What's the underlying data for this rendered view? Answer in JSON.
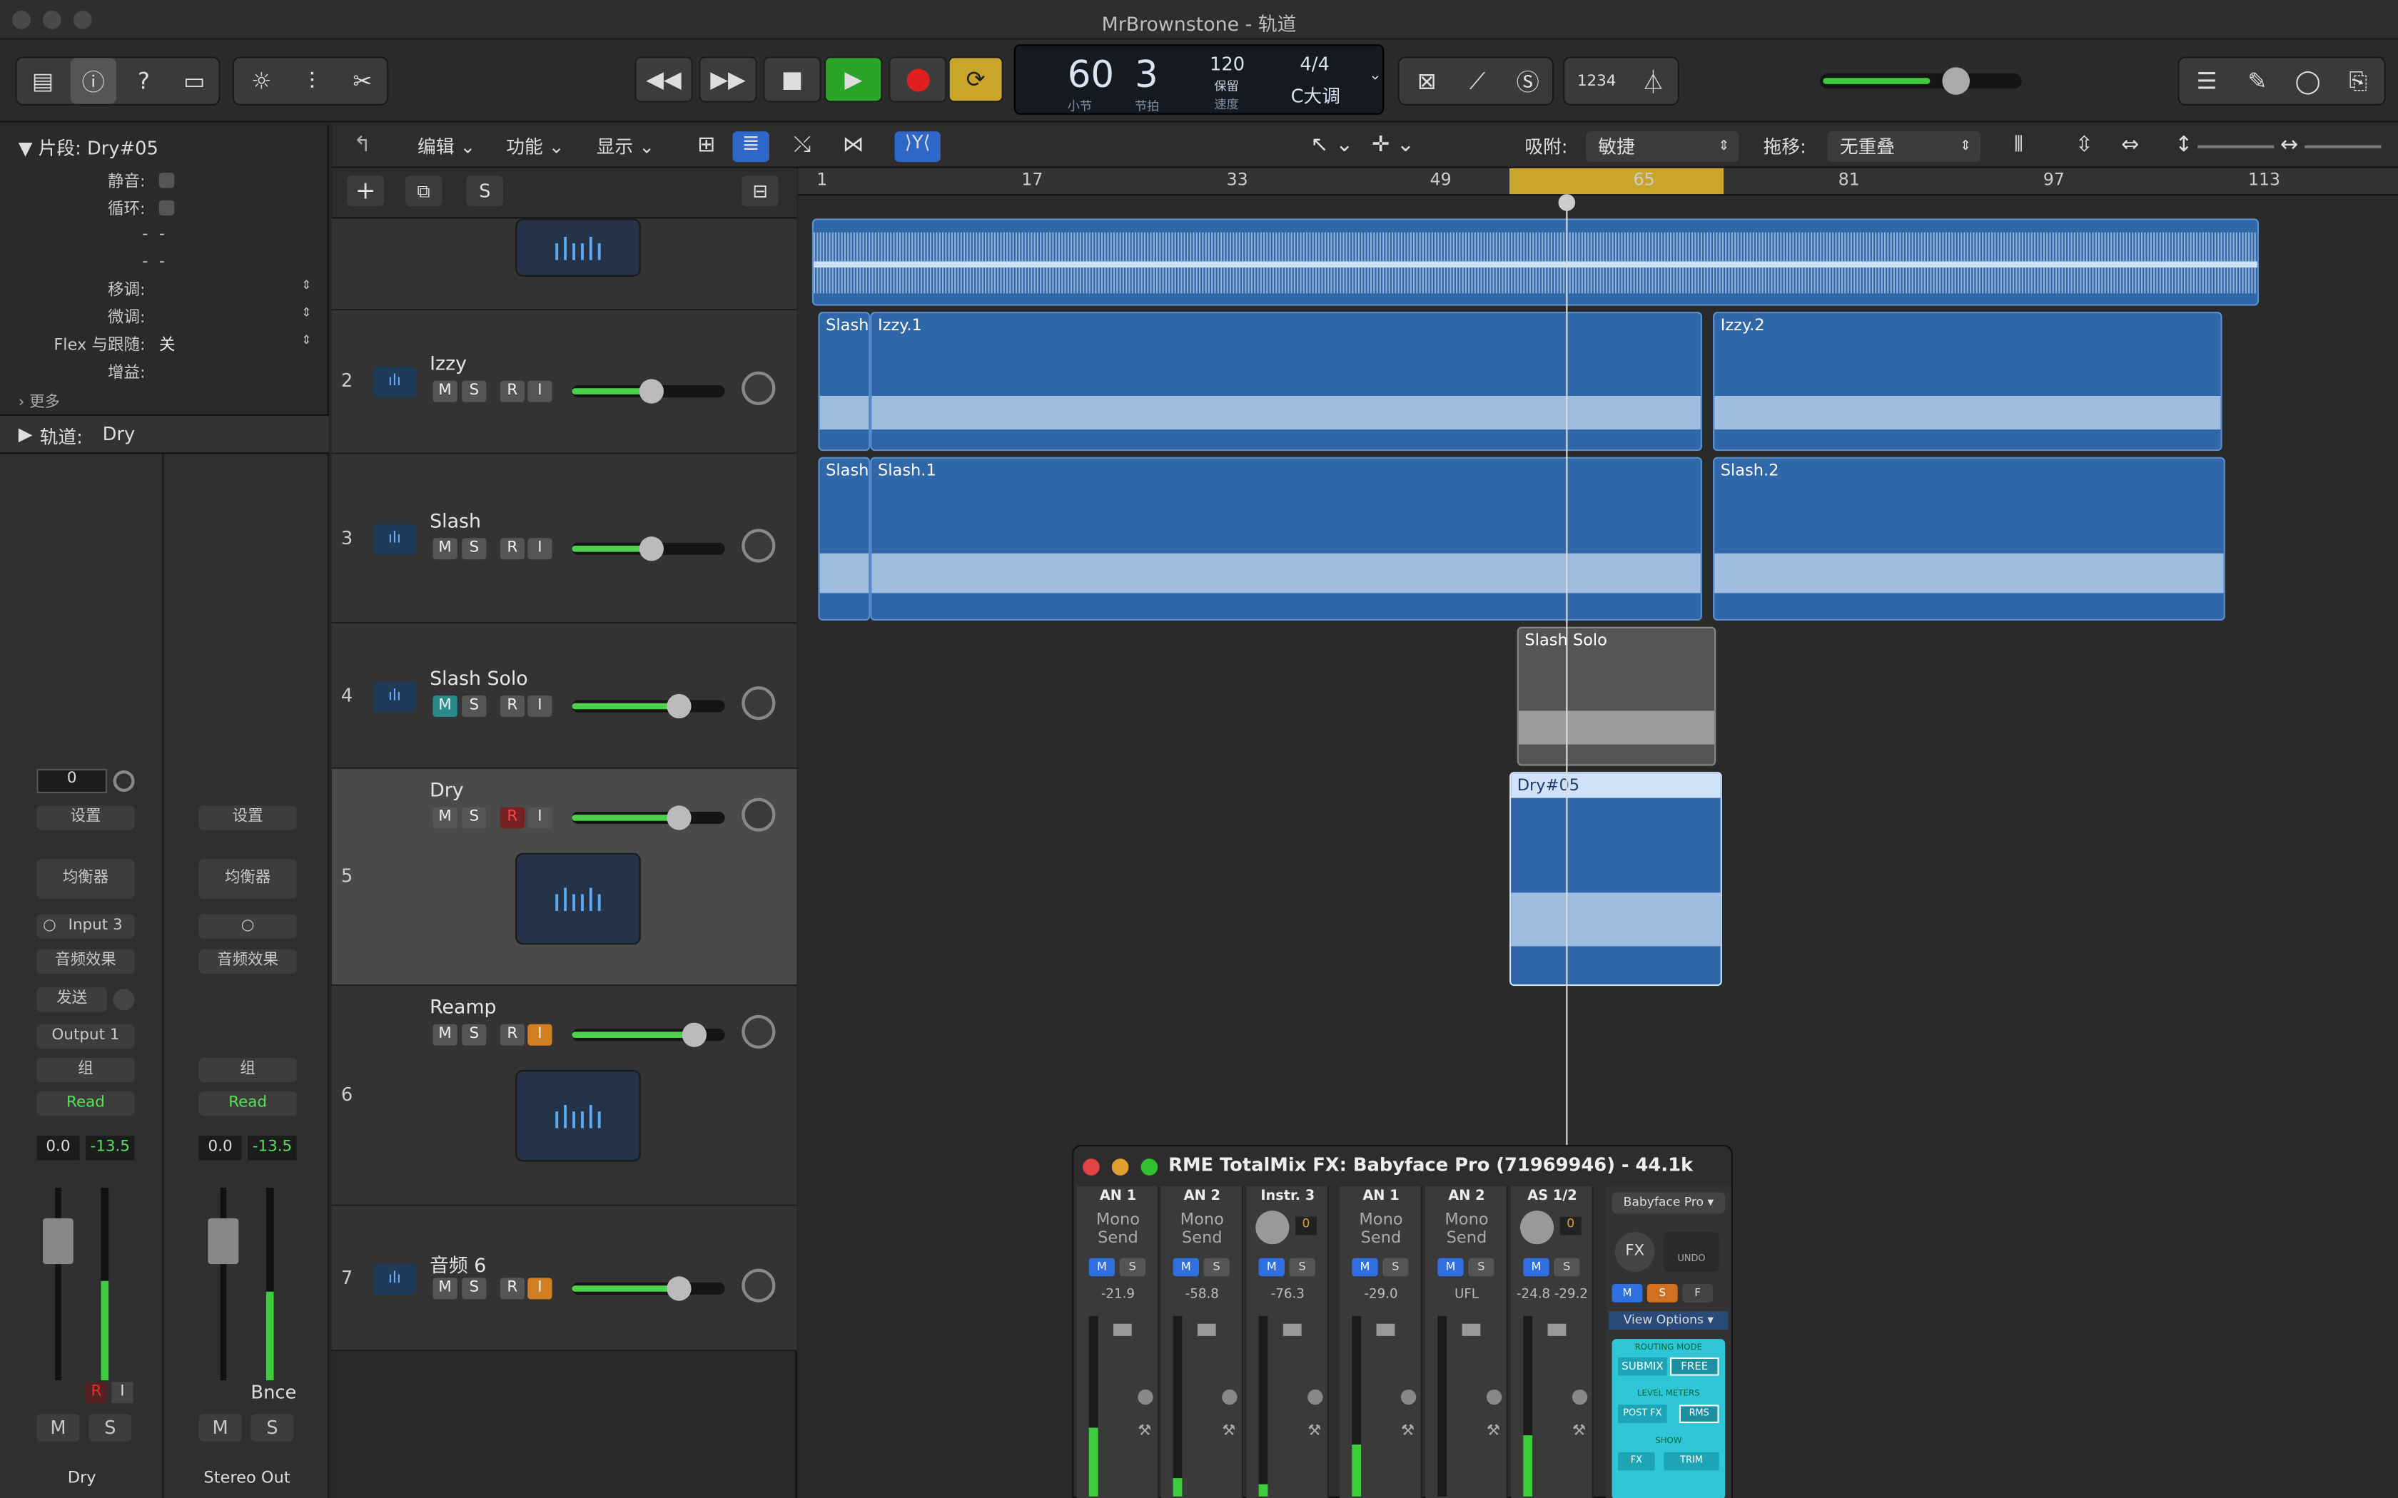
{
  "window": {
    "title": "MrBrownstone - 轨道"
  },
  "lcd": {
    "bar": "60",
    "beat": "3",
    "bar_label": "小节",
    "beat_label": "节拍",
    "tempo": "120",
    "tempo_mode": "保留",
    "tempo_label": "速度",
    "signature": "4/4",
    "key": "C大调"
  },
  "count_in": "1234",
  "inspector": {
    "region_header_arrow": "▼",
    "region_header_label": "片段:",
    "region_name": "Dry#05",
    "rows": [
      {
        "label": "静音:",
        "value": ""
      },
      {
        "label": "循环:",
        "value": ""
      },
      {
        "label": "-",
        "value": "-"
      },
      {
        "label": "-",
        "value": "-"
      },
      {
        "label": "移调:",
        "value": ""
      },
      {
        "label": "微调:",
        "value": ""
      },
      {
        "label": "Flex 与跟随:",
        "value": "关"
      },
      {
        "label": "增益:",
        "value": ""
      }
    ],
    "more": "更多",
    "track_header_label": "轨道:",
    "track_name": "Dry"
  },
  "strips": [
    {
      "name": "Dry",
      "value": "0",
      "setting": "设置",
      "eq": "均衡器",
      "input": "Input 3",
      "fx": "音频效果",
      "send": "发送",
      "output": "Output 1",
      "group": "组",
      "automation": "Read",
      "vol": "0.0",
      "peak": "-13.5",
      "r": "R",
      "i": "I",
      "m": "M",
      "s": "S"
    },
    {
      "name": "Stereo Out",
      "setting": "设置",
      "eq": "均衡器",
      "input": "",
      "fx": "音频效果",
      "group": "组",
      "automation": "Read",
      "vol": "0.0",
      "peak": "-13.5",
      "bnce": "Bnce",
      "m": "M",
      "s": "S"
    }
  ],
  "meter_scale": [
    "0",
    "3",
    "6",
    "9",
    "12",
    "15",
    "18",
    "21",
    "24",
    "30",
    "35",
    "40",
    "45",
    "50",
    "60"
  ],
  "track_header": {
    "menus": [
      "编辑",
      "功能",
      "显示"
    ],
    "snap_label": "吸附:",
    "snap_value": "敏捷",
    "drag_label": "拖移:",
    "drag_value": "无重叠"
  },
  "tracks": [
    {
      "num": "2",
      "name": "Izzy",
      "vol": 0.52,
      "r_armed": false,
      "i_active": false,
      "selected": false
    },
    {
      "num": "3",
      "name": "Slash",
      "vol": 0.52,
      "r_armed": false,
      "i_active": false,
      "selected": false
    },
    {
      "num": "4",
      "name": "Slash Solo",
      "vol": 0.7,
      "r_armed": false,
      "i_active": false,
      "selected": false,
      "muted": true
    },
    {
      "num": "5",
      "name": "Dry",
      "vol": 0.7,
      "r_armed": true,
      "i_active": false,
      "selected": true
    },
    {
      "num": "6",
      "name": "Reamp",
      "vol": 0.8,
      "r_armed": false,
      "i_active": true,
      "selected": false
    },
    {
      "num": "7",
      "name": "音频 6",
      "vol": 0.7,
      "r_armed": false,
      "i_active": true,
      "selected": false
    }
  ],
  "msri": {
    "m": "M",
    "s": "S",
    "r": "R",
    "i": "I"
  },
  "ruler": [
    "1",
    "17",
    "33",
    "49",
    "65",
    "81",
    "97",
    "113"
  ],
  "regions": [
    {
      "name": "Slash",
      "track": 2
    },
    {
      "name": "Izzy.1",
      "track": 2
    },
    {
      "name": "Izzy.2",
      "track": 2
    },
    {
      "name": "Slash",
      "track": 3
    },
    {
      "name": "Slash.1",
      "track": 3
    },
    {
      "name": "Slash.2",
      "track": 3
    },
    {
      "name": "Slash Solo",
      "track": 4
    },
    {
      "name": "Dry#05",
      "track": 5
    }
  ],
  "rme": {
    "title": "RME TotalMix FX: Babyface Pro (71969946) - 44.1k",
    "device": "Babyface Pro ▾",
    "view_options": "View Options",
    "routing_mode": "ROUTING MODE",
    "submix": "SUBMIX",
    "free": "FREE",
    "level_meters": "LEVEL METERS",
    "post_fx": "POST FX",
    "rms": "RMS",
    "show": "SHOW",
    "fx_btn": "FX",
    "trim": "TRIM",
    "fx_label": "FX",
    "undo": "UNDO",
    "msf": [
      "M",
      "S",
      "F"
    ],
    "channels": [
      {
        "name": "AN 1",
        "l1": "Mono",
        "l2": "Send",
        "val": "-21.9"
      },
      {
        "name": "AN 2",
        "l1": "Mono",
        "l2": "Send",
        "val": "-58.8"
      },
      {
        "name": "Instr. 3",
        "l1": "",
        "l2": "",
        "val": "-76.3",
        "knob": "0"
      },
      {
        "name": "AN 1",
        "l1": "Mono",
        "l2": "Send",
        "val": "-29.0"
      },
      {
        "name": "AN 2",
        "l1": "Mono",
        "l2": "Send",
        "val": "UFL"
      },
      {
        "name": "AS 1/2",
        "l1": "",
        "l2": "",
        "val": "-24.8 -29.2",
        "knob": "0"
      }
    ]
  },
  "colors": {
    "accent": "#2f67a8",
    "play": "#2aa52a",
    "record": "#e02020",
    "cycle": "#c9a52a",
    "meter": "#3ccc3c"
  }
}
